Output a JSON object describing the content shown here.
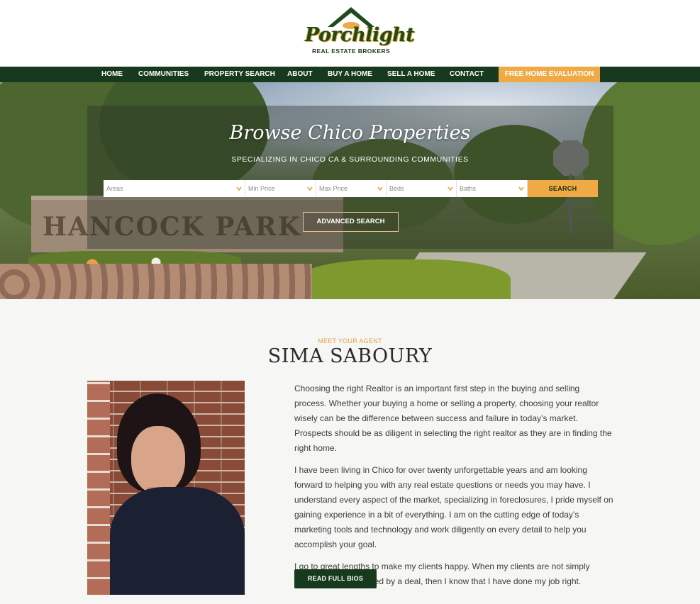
{
  "brand": {
    "name": "Porchlight",
    "tagline": "REAL ESTATE BROKERS",
    "colors": {
      "green": "#173a1e",
      "gold": "#f0aa45"
    }
  },
  "nav": {
    "items": [
      "HOME",
      "COMMUNITIES",
      "PROPERTY SEARCH",
      "ABOUT",
      "BUY A HOME",
      "SELL A HOME",
      "CONTACT"
    ],
    "cta": "FREE HOME EVALUATION"
  },
  "hero": {
    "title": "Browse Chico Properties",
    "subtitle": "SPECIALIZING IN CHICO CA & SURROUNDING COMMUNITIES",
    "sign_text": "HANCOCK PARK",
    "filters": [
      {
        "label": "Areas",
        "icon": "chevron-down-icon"
      },
      {
        "label": "Min Price",
        "icon": "chevron-down-icon"
      },
      {
        "label": "Max Price",
        "icon": "chevron-down-icon"
      },
      {
        "label": "Beds",
        "icon": "chevron-down-icon"
      },
      {
        "label": "Baths",
        "icon": "chevron-down-icon"
      }
    ],
    "search_label": "SEARCH",
    "advanced_label": "ADVANCED SEARCH"
  },
  "agent": {
    "eyebrow": "MEET YOUR AGENT",
    "name": "SIMA SABOURY",
    "bio": [
      "Choosing the right Realtor is an important first step in the buying and selling process. Whether your buying a home or selling a property, choosing your realtor wisely can be the difference between success and failure in today’s market. Prospects should be as diligent in selecting the right realtor as they are in finding the right home.",
      "I have been living in Chico for over twenty unforgettable years and am looking forward to helping you with any real estate questions or needs you may have. I understand every aspect of the market, specializing in foreclosures, I pride myself on gaining experience in a bit of everything. I am on the cutting edge of today’s marketing tools and technology and work diligently on every detail to help you accomplish your goal.",
      "I go to great lengths to make my clients happy. When my clients are not simply satisfied, but impressed by a deal, then I know that I have done my job right."
    ],
    "button_label": "READ FULL BIOS"
  }
}
